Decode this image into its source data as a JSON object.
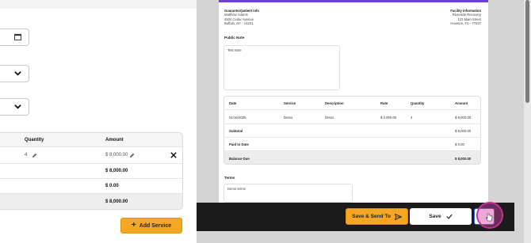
{
  "left": {
    "table": {
      "headers": {
        "quantity": "Quantity",
        "amount": "Amount"
      },
      "row": {
        "quantity": "4",
        "amount": "$ 8,000.00"
      },
      "subtotal": "$ 8,000.00",
      "paid": "$ 0.00",
      "balance": "$ 8,000.00"
    },
    "add_service_label": "Add Service"
  },
  "preview": {
    "guarantor": {
      "heading": "Guarantor/patient info",
      "name": "Matthew Adams",
      "address1": "4504 Cedar Avenue",
      "address2": "Buffalo, NY - 14201"
    },
    "facility": {
      "heading": "Facility information",
      "name": "Riverside Recovery",
      "address1": "123 Main Street",
      "address2": "Houston, TX - 77027"
    },
    "public_note_label": "Public Note",
    "public_note_value": "Test Note",
    "table": {
      "headers": [
        "Date",
        "Service",
        "Description",
        "Rate",
        "Quantity",
        "Amount"
      ],
      "row": [
        "01/16/2025",
        "Detox",
        "Detox",
        "$ 2,000.00",
        "4",
        "$ 8,000.00"
      ],
      "subtotal_label": "Subtotal",
      "subtotal": "$ 8,000.00",
      "paid_label": "Paid to Date",
      "paid": "$ 0.00",
      "balance_label": "Balance Due",
      "balance": "$ 8,000.00"
    },
    "terms_label": "Terms",
    "terms_value": "Demo terms"
  },
  "actions": {
    "save_send_label": "Save & Send To",
    "save_label": "Save"
  },
  "colors": {
    "accent": "#f5a623",
    "brand": "#6e3fd6",
    "cursor": "#c0358e"
  }
}
